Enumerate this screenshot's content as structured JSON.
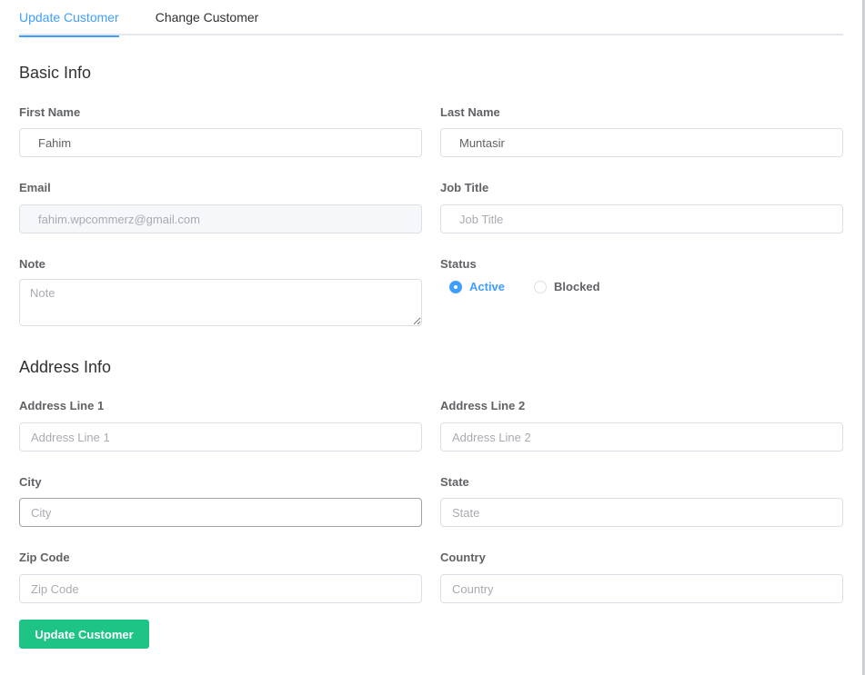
{
  "tabs": [
    {
      "label": "Update Customer",
      "active": true
    },
    {
      "label": "Change Customer",
      "active": false
    }
  ],
  "basic_info": {
    "title": "Basic Info",
    "first_name": {
      "label": "First Name",
      "value": "Fahim"
    },
    "last_name": {
      "label": "Last Name",
      "value": "Muntasir"
    },
    "email": {
      "label": "Email",
      "value": "fahim.wpcommerz@gmail.com"
    },
    "job_title": {
      "label": "Job Title",
      "placeholder": "Job Title"
    },
    "note": {
      "label": "Note",
      "placeholder": "Note"
    },
    "status": {
      "label": "Status",
      "options": [
        {
          "label": "Active",
          "checked": true
        },
        {
          "label": "Blocked",
          "checked": false
        }
      ]
    }
  },
  "address_info": {
    "title": "Address Info",
    "address_line_1": {
      "label": "Address Line 1",
      "placeholder": "Address Line 1"
    },
    "address_line_2": {
      "label": "Address Line 2",
      "placeholder": "Address Line 2"
    },
    "city": {
      "label": "City",
      "placeholder": "City"
    },
    "state": {
      "label": "State",
      "placeholder": "State"
    },
    "zip_code": {
      "label": "Zip Code",
      "placeholder": "Zip Code"
    },
    "country": {
      "label": "Country",
      "placeholder": "Country"
    }
  },
  "submit_label": "Update Customer",
  "colors": {
    "accent": "#409eff",
    "submit": "#1ec485"
  }
}
